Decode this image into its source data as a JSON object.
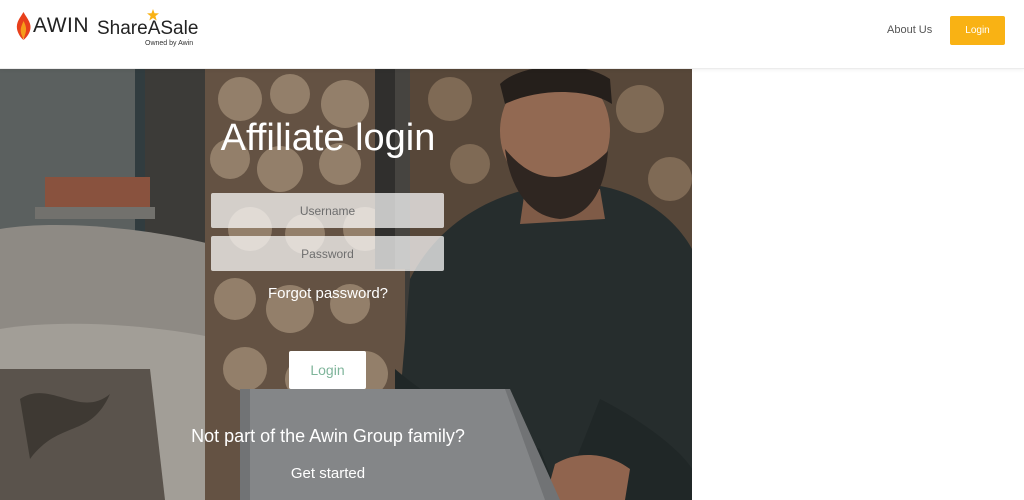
{
  "header": {
    "awin_logo_text": "AWIN",
    "shareasale_logo_text": "ShareASale",
    "shareasale_tagline": "Owned by Awin",
    "nav": {
      "about_label": "About Us",
      "login_label": "Login"
    }
  },
  "hero": {
    "title": "Affiliate login",
    "username_placeholder": "Username",
    "password_placeholder": "Password",
    "forgot_label": "Forgot password?",
    "login_label": "Login",
    "not_part_text": "Not part of the Awin Group family?",
    "get_started_label": "Get started",
    "background_image": "man-with-laptop-photo"
  },
  "colors": {
    "accent_orange": "#f9b214",
    "login_text_green": "#7fb59b",
    "awin_flame_red": "#e8401c",
    "awin_flame_orange": "#f59c1a"
  }
}
